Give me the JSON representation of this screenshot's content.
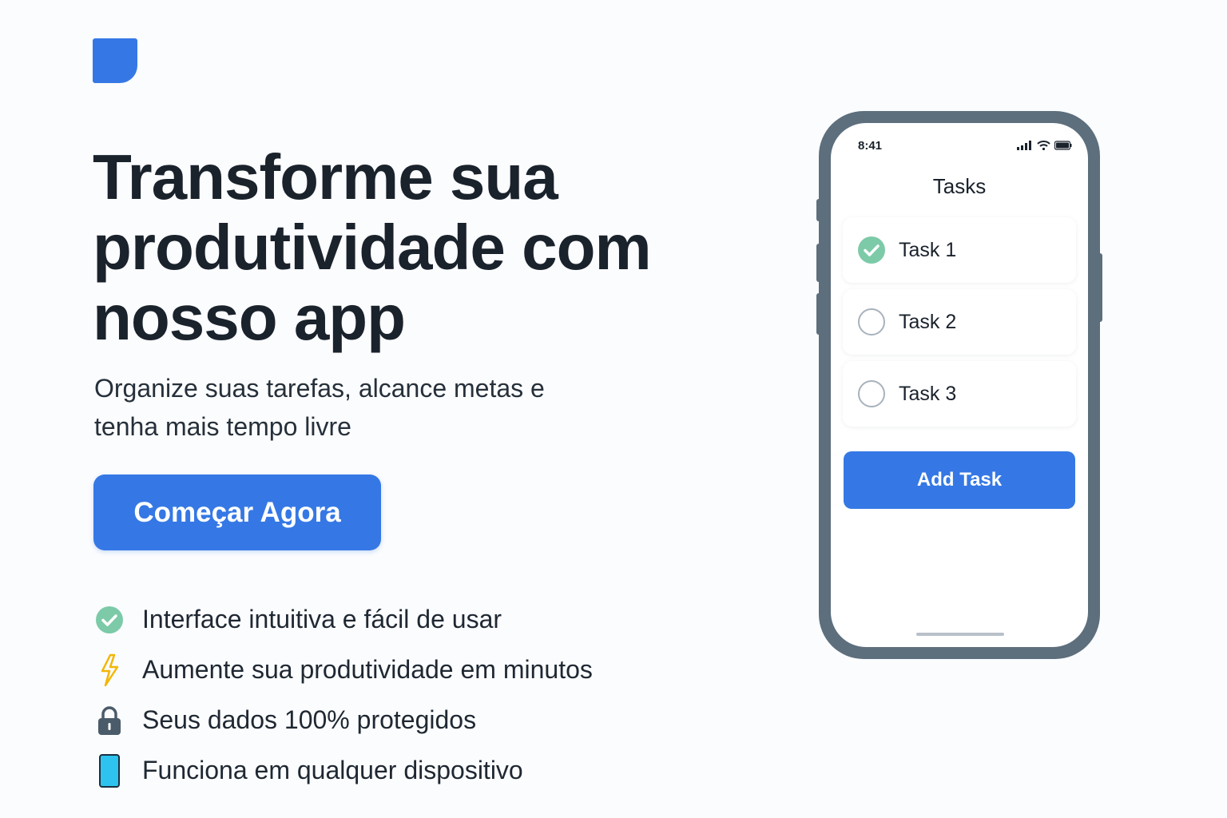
{
  "brand": {
    "logo_icon": "app-logo-icon",
    "accent": "#3578e5"
  },
  "hero": {
    "title": "Transforme sua produtividade com nosso app",
    "subtitle": "Organize suas tarefas, alcance metas e tenha mais tempo livre",
    "cta_label": "Começar Agora"
  },
  "features": [
    {
      "icon": "check-circle-icon",
      "text": "Interface intuitiva e fácil de usar"
    },
    {
      "icon": "lightning-icon",
      "text": "Aumente sua produtividade em minutos"
    },
    {
      "icon": "lock-icon",
      "text": "Seus dados 100% protegidos"
    },
    {
      "icon": "smartphone-icon",
      "text": "Funciona em qualquer dispositivo"
    }
  ],
  "phone": {
    "status_time": "8:41",
    "screen_title": "Tasks",
    "tasks": [
      {
        "label": "Task 1",
        "done": true
      },
      {
        "label": "Task 2",
        "done": false
      },
      {
        "label": "Task 3",
        "done": false
      }
    ],
    "add_button_label": "Add Task"
  },
  "colors": {
    "check_green": "#7ccaa8",
    "bolt_yellow": "#f2b705",
    "lock_slate": "#4a5b6a",
    "phone_cyan": "#2ec3ef",
    "phone_frame": "#5d6e7c"
  }
}
